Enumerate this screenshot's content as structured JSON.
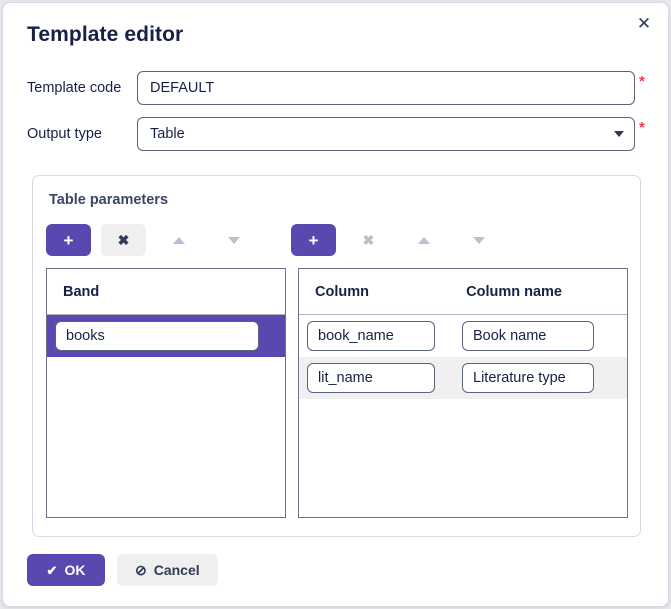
{
  "dialog": {
    "title": "Template editor",
    "close_icon": "close-icon",
    "accent_color": "#5a48b0",
    "required_marker": "*",
    "required_color": "#f1394f"
  },
  "form": {
    "template_code": {
      "label": "Template code",
      "value": "DEFAULT",
      "placeholder": "",
      "required": true
    },
    "output_type": {
      "label": "Output type",
      "value": "Table",
      "placeholder": "",
      "required": true,
      "caret_icon": "chevron-down-icon",
      "options": [
        "Table"
      ]
    }
  },
  "table_parameters": {
    "legend": "Table parameters",
    "band_toolbar": [
      {
        "name": "add-band-button",
        "icon": "plus-icon",
        "glyph": "+",
        "style": "primary",
        "enabled": true
      },
      {
        "name": "remove-band-button",
        "icon": "close-icon",
        "glyph": "✖",
        "style": "grey",
        "enabled": true
      },
      {
        "name": "move-band-up-button",
        "icon": "arrow-up-icon",
        "glyph": "",
        "style": "plain",
        "enabled": false
      },
      {
        "name": "move-band-down-button",
        "icon": "arrow-down-icon",
        "glyph": "",
        "style": "plain",
        "enabled": false
      }
    ],
    "column_toolbar": [
      {
        "name": "add-column-button",
        "icon": "plus-icon",
        "glyph": "+",
        "style": "primary",
        "enabled": true
      },
      {
        "name": "remove-column-button",
        "icon": "close-icon",
        "glyph": "✖",
        "style": "plain",
        "enabled": false
      },
      {
        "name": "move-column-up-button",
        "icon": "arrow-up-icon",
        "glyph": "",
        "style": "plain",
        "enabled": false
      },
      {
        "name": "move-column-down-button",
        "icon": "arrow-down-icon",
        "glyph": "",
        "style": "plain",
        "enabled": false
      }
    ],
    "band_grid": {
      "headers": [
        "Band"
      ],
      "rows": [
        {
          "values": [
            "books"
          ],
          "selected": true
        }
      ]
    },
    "column_grid": {
      "headers": [
        "Column",
        "Column name"
      ],
      "rows": [
        {
          "values": [
            "book_name",
            "Book name"
          ],
          "selected": false,
          "alt": false
        },
        {
          "values": [
            "lit_name",
            "Literature type"
          ],
          "selected": false,
          "alt": true
        }
      ]
    }
  },
  "footer": {
    "ok": {
      "label": "OK",
      "icon": "check-icon",
      "glyph": "✔"
    },
    "cancel": {
      "label": "Cancel",
      "icon": "ban-icon",
      "glyph": "⊘"
    }
  }
}
